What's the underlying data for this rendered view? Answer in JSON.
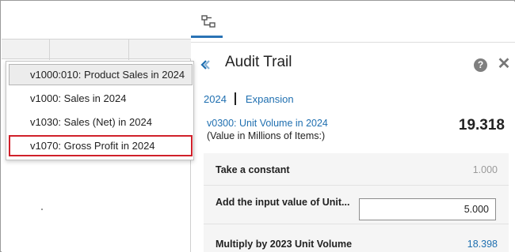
{
  "menu": {
    "items": [
      "v1000:010: Product Sales in 2024",
      "v1000: Sales in 2024",
      "v1030: Sales (Net) in 2024",
      "v1070: Gross Profit in 2024"
    ]
  },
  "panel": {
    "tab_icon": "hierarchy-icon",
    "title": "Audit Trail",
    "help_label": "?",
    "close_label": "✕",
    "breadcrumbs": [
      "2024",
      "Expansion"
    ],
    "metric": {
      "name": "v0300: Unit Volume in 2024",
      "subtitle": "(Value in Millions of Items:)",
      "value": "19.318"
    },
    "steps": [
      {
        "label": "Take a constant",
        "value": "1.000"
      },
      {
        "label": "Add the input value of Unit...",
        "input_value": "5.000"
      },
      {
        "label": "Multiply by 2023 Unit Volume",
        "value": "18.398"
      }
    ]
  },
  "colors": {
    "link": "#1f6fb0",
    "accent_tab": "#2a73b5",
    "highlight_border": "#d0202a"
  }
}
